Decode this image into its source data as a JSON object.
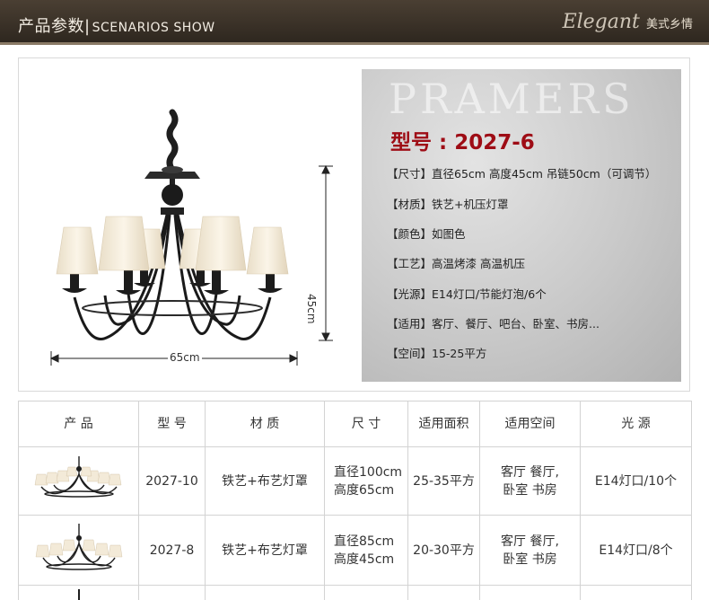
{
  "banner": {
    "title_cn": "产品参数",
    "title_en": "SCENARIOS SHOW",
    "brand_script": "Elegant",
    "brand_cn": "美式乡情"
  },
  "product": {
    "dimension_height": "45cm",
    "dimension_width": "65cm",
    "watermark": "PRAMERS",
    "model_line": "型号 : 2027-6",
    "specs": [
      {
        "label": "【尺寸】",
        "value": "直径65cm 高度45cm 吊链50cm（可调节）"
      },
      {
        "label": "【材质】",
        "value": "铁艺+机压灯罩"
      },
      {
        "label": "【颜色】",
        "value": "如图色"
      },
      {
        "label": "【工艺】",
        "value": "高温烤漆 高温机压"
      },
      {
        "label": "【光源】",
        "value": "E14灯口/节能灯泡/6个"
      },
      {
        "label": "【适用】",
        "value": "客厅、餐厅、吧台、卧室、书房..."
      },
      {
        "label": "【空间】",
        "value": "15-25平方"
      }
    ]
  },
  "table": {
    "headers": [
      "产 品",
      "型 号",
      "材 质",
      "尺 寸",
      "适用面积",
      "适用空间",
      "光 源"
    ],
    "rows": [
      {
        "model": "2027-10",
        "material": "铁艺+布艺灯罩",
        "size_1": "直径100cm",
        "size_2": "高度65cm",
        "area": "25-35平方",
        "space_1": "客厅 餐厅,",
        "space_2": "卧室 书房",
        "light": "E14灯口/10个"
      },
      {
        "model": "2027-8",
        "material": "铁艺+布艺灯罩",
        "size_1": "直径85cm",
        "size_2": "高度45cm",
        "area": "20-30平方",
        "space_1": "客厅 餐厅,",
        "space_2": "卧室 书房",
        "light": "E14灯口/8个"
      }
    ]
  },
  "colors": {
    "banner_bg": "#3b3228",
    "model_red": "#9e0c15",
    "shade_cream": "#f6efe0",
    "iron_black": "#1e1e1e"
  }
}
